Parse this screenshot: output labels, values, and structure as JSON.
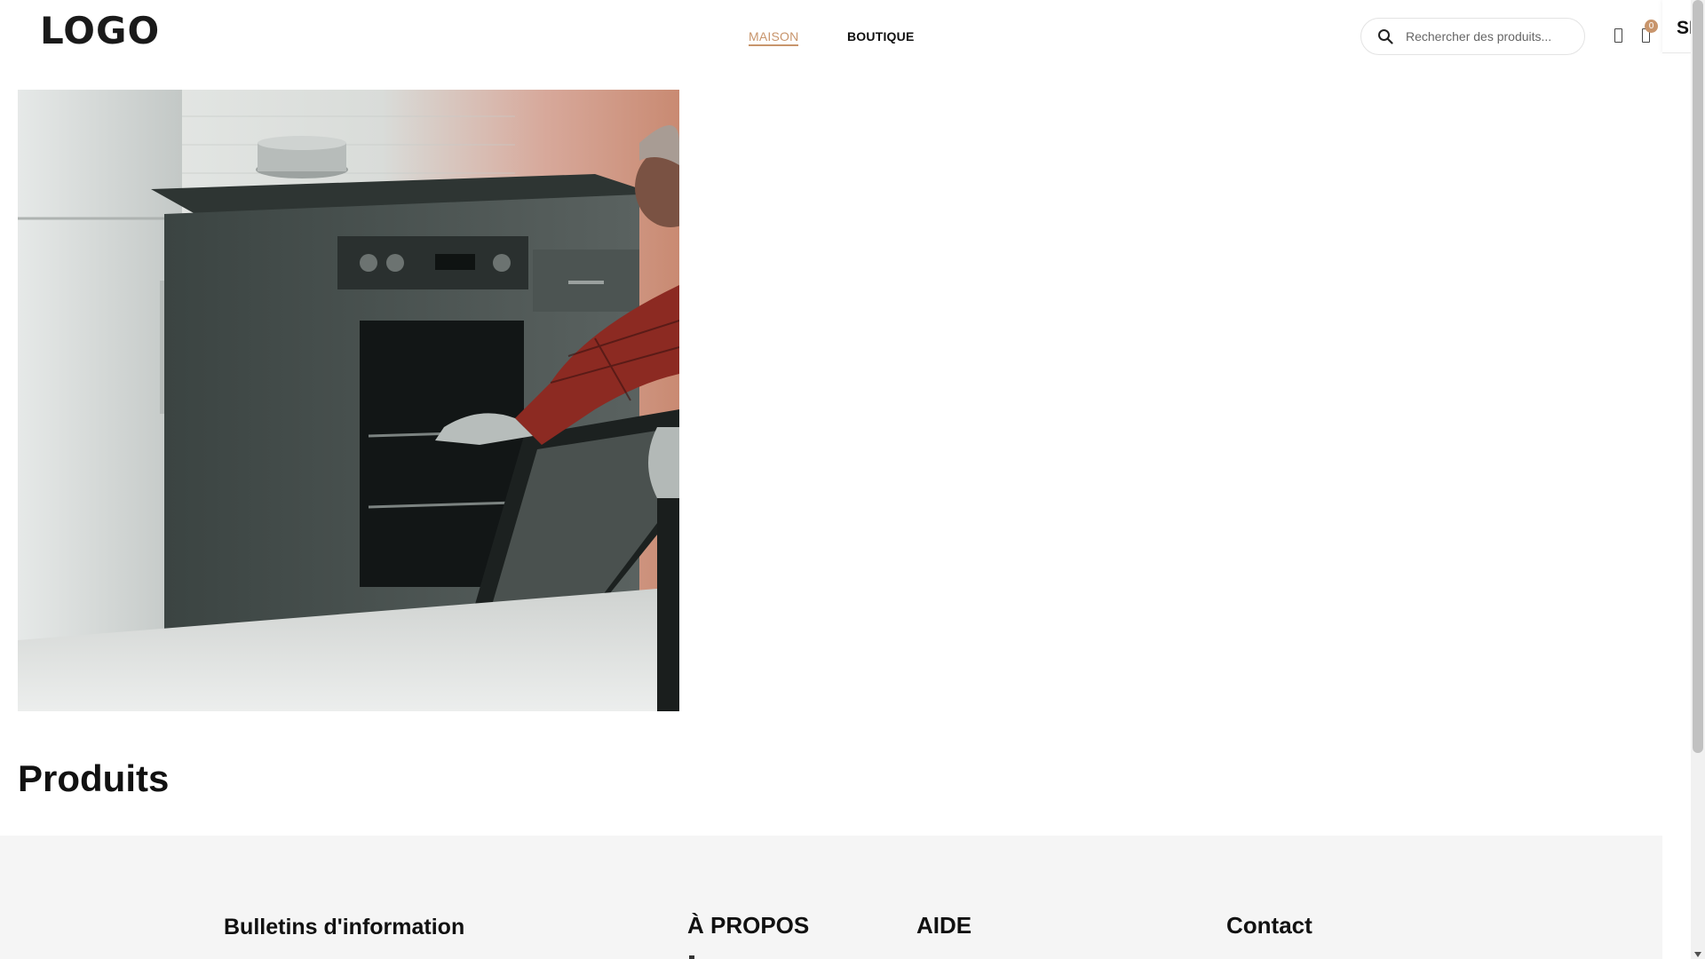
{
  "header": {
    "logo": "LOGO",
    "nav": [
      {
        "label": "MAISON",
        "active": true
      },
      {
        "label": "BOUTIQUE",
        "active": false
      }
    ],
    "search": {
      "placeholder": "Rechercher des produits...",
      "value": ""
    },
    "cart_count": "0",
    "side_tab_label": "SI"
  },
  "hero": {
    "image_subject": "technician-repairing-oven-photo"
  },
  "main": {
    "section_title": "Produits"
  },
  "footer": {
    "newsletter_title": "Bulletins d'information",
    "about_title": "À PROPOS",
    "help_title": "AIDE",
    "contact_title": "Contact"
  },
  "colors": {
    "accent": "#c8956c",
    "text": "#111111",
    "footer_bg": "#f5f5f5"
  }
}
